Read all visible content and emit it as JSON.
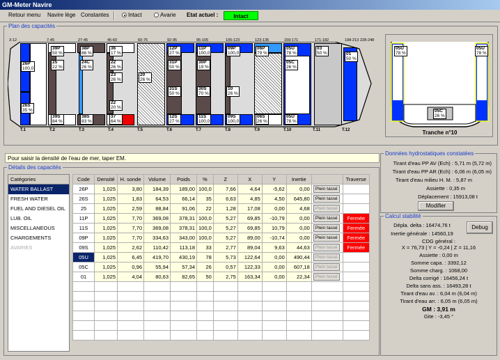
{
  "window": {
    "title": "GM-Meter Navire"
  },
  "menu": {
    "retour": "Retour menu",
    "navire": "Navire lège",
    "constantes": "Constantes",
    "intact": "Intact",
    "avarie": "Avarie",
    "etat_label": "Etat actuel :",
    "etat_value": "Intact"
  },
  "plan": {
    "title": "Plan des capacités",
    "frames": [
      "3-12",
      "7-45",
      "27-45",
      "45-60",
      "60-75",
      "92-95",
      "95-105",
      "105-123",
      "123-135",
      "159-171",
      "171-182",
      "198-213",
      "228-248"
    ],
    "ticks": [
      "T.1",
      "T.2",
      "T.3",
      "T.4",
      "T.5",
      "T.6",
      "T.7",
      "T.8",
      "T.9",
      "T.10",
      "T.11",
      "T.12"
    ],
    "labels": [
      {
        "c": "26P",
        "v": "100,0"
      },
      {
        "c": "26S",
        "v": "35 %"
      },
      {
        "c": "39P",
        "v": "50 %"
      },
      {
        "c": "25",
        "v": "22 %"
      },
      {
        "c": "39S",
        "v": "84 %"
      },
      {
        "c": "38P",
        "v": "86 %"
      },
      {
        "c": "24C",
        "v": "26 %"
      },
      {
        "c": "38S",
        "v": "83 %"
      },
      {
        "c": "36",
        "v": "17 %"
      },
      {
        "c": "22",
        "v": "26 %"
      },
      {
        "c": "23",
        "v": "26 %"
      },
      {
        "c": "22",
        "v": "20 %"
      },
      {
        "c": "37",
        "v": "64 %"
      },
      {
        "c": "20",
        "v": "26 %"
      },
      {
        "c": "12P",
        "v": "27 %"
      },
      {
        "c": "31P",
        "v": "50 %"
      },
      {
        "c": "31S",
        "v": "50 %"
      },
      {
        "c": "12S",
        "v": "27 %"
      },
      {
        "c": "11P",
        "v": "100,0"
      },
      {
        "c": "30P",
        "v": "19 %"
      },
      {
        "c": "30S",
        "v": "70 %"
      },
      {
        "c": "11S",
        "v": "100,0"
      },
      {
        "c": "09P",
        "v": "100,0"
      },
      {
        "c": "10",
        "v": "26 %"
      },
      {
        "c": "09S",
        "v": "100,0"
      },
      {
        "c": "06P",
        "v": "79 %"
      },
      {
        "c": "06S",
        "v": "26 %"
      },
      {
        "c": "05U",
        "v": "78 %"
      },
      {
        "c": "05C",
        "v": "26 %"
      },
      {
        "c": "05U",
        "v": "78 %"
      },
      {
        "c": "03",
        "v": "50 %"
      },
      {
        "c": "01",
        "v": "50 %"
      }
    ]
  },
  "section": {
    "title": "Tranche n°10",
    "l1": "05U",
    "v1": "78 %",
    "l2": "05U",
    "v2": "78 %",
    "l3": "05C",
    "v3": "26 %"
  },
  "info": {
    "text": "Pour saisir la densité de l'eau de mer, taper EM."
  },
  "details": {
    "title": "Détails des capacités",
    "categories_header": "Catégories",
    "categories": [
      "WATER BALLAST",
      "FRESH WATER",
      "FUEL AND DIESEL OIL",
      "LUB. OIL",
      "MISCELLANEOUS",
      "CHARGEMENTS",
      "AVARIES"
    ],
    "columns": [
      "Code",
      "Densité",
      "H. sonde",
      "Volume",
      "Poids",
      "%",
      "Z",
      "X",
      "Y",
      "Inertie",
      "",
      "Traverse"
    ],
    "plein": "Plein tassé",
    "fermee": "Fermée",
    "rows": [
      [
        "26P",
        "1,025",
        "3,80",
        "184,39",
        "189,00",
        "100,0",
        "7,66",
        "4,64",
        "-5,62",
        "0,00",
        "p",
        ""
      ],
      [
        "26S",
        "1,025",
        "1,83",
        "64,53",
        "66,14",
        "35",
        "6,63",
        "4,85",
        "4,50",
        "645,80",
        "p",
        ""
      ],
      [
        "25",
        "1,025",
        "2,59",
        "88,84",
        "91,06",
        "22",
        "1,28",
        "17,08",
        "0,00",
        "4,68",
        "d",
        ""
      ],
      [
        "11P",
        "1,025",
        "7,70",
        "369,08",
        "378,31",
        "100,0",
        "5,27",
        "69,85",
        "-10,79",
        "0,00",
        "p",
        "f"
      ],
      [
        "11S",
        "1,025",
        "7,70",
        "369,08",
        "378,31",
        "100,0",
        "5,27",
        "69,85",
        "10,79",
        "0,00",
        "p",
        "f"
      ],
      [
        "09P",
        "1,025",
        "7,70",
        "334,63",
        "343,00",
        "100,0",
        "5,27",
        "89,00",
        "-10,74",
        "0,00",
        "p",
        "f"
      ],
      [
        "09S",
        "1,025",
        "2,62",
        "110,42",
        "113,18",
        "33",
        "2,77",
        "89,04",
        "9,63",
        "44,63",
        "d",
        "f"
      ],
      [
        "05U",
        "1,025",
        "6,45",
        "419,70",
        "430,19",
        "78",
        "5,73",
        "122,64",
        "0,00",
        "490,44",
        "d",
        ""
      ],
      [
        "05C",
        "1,025",
        "0,96",
        "55,94",
        "57,34",
        "26",
        "0,57",
        "122,33",
        "0,00",
        "607,18",
        "d",
        ""
      ],
      [
        "01",
        "1,025",
        "4,04",
        "80,63",
        "82,65",
        "50",
        "2,75",
        "163,34",
        "0,00",
        "22,34",
        "d",
        ""
      ]
    ]
  },
  "hydro": {
    "title": "Données hydrostatiques constatées",
    "l1": "Tirant d'eau PP AV (Ech) : 5,71 m  (5,72 m)",
    "l2": "Tirant d'eau PP AR (Ech) : 6,06 m  (6,05 m)",
    "l3": "Tirant d'eau milieu H. M. : 5,87 m",
    "l4": "Assiette : 0,35 m",
    "l5": "Déplacement : 15913,08 t",
    "btn": "Modifier"
  },
  "stab": {
    "title": "Calcul stabilité",
    "lines": [
      "Dépla. delta : 16474,76 t",
      "Inertie générale : 14560,19",
      "CDG général :",
      "X = 76,73 | Y = -0,24 | Z = 11,16",
      "Assiette : 0,00 m",
      "Somme capa. : 3392,12",
      "Somme charg. : 1068,00",
      "Delta corrigé : 16456,24 t",
      "Delta sans ass. : 16493,28 t",
      "Tirant d'eau av. : 6,04 m (6,04 m)",
      "Tirant d'eau arr. : 6,05 m (6,05 m)",
      "GM : 3,91 m",
      "Gite : -3,45 °"
    ],
    "debug": "Debug"
  }
}
